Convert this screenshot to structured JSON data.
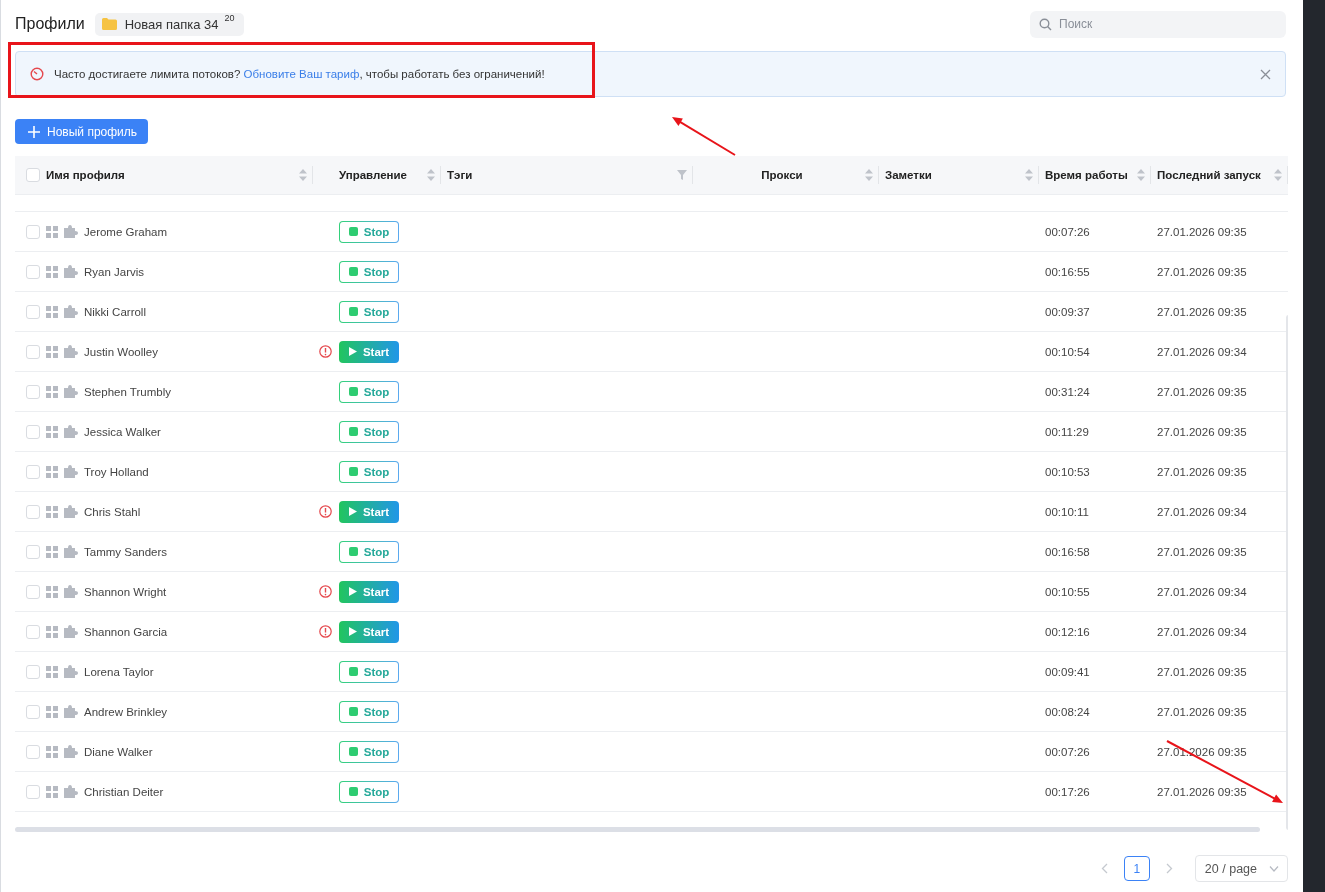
{
  "header": {
    "title": "Профили",
    "folder": {
      "name": "Новая папка 34",
      "count": "20"
    },
    "search": {
      "placeholder": "Поиск"
    }
  },
  "banner": {
    "text_before": "Часто достигаете лимита потоков? ",
    "link": "Обновите Ваш тариф",
    "text_after": ", чтобы работать без ограничений!"
  },
  "new_profile_button": {
    "label": "Новый профиль"
  },
  "table": {
    "select_all_checked": false,
    "columns": [
      {
        "label": "Имя профиля",
        "kind": "sort"
      },
      {
        "label": "Управление",
        "kind": "sort"
      },
      {
        "label": "Тэги",
        "kind": "filter"
      },
      {
        "label": "Прокси",
        "kind": "sort"
      },
      {
        "label": "Заметки",
        "kind": "sort"
      },
      {
        "label": "Время работы",
        "kind": "sort"
      },
      {
        "label": "Последний запуск",
        "kind": "sort"
      }
    ],
    "rows": [
      {
        "checked": false,
        "name": "Jerome Graham",
        "warning": false,
        "control": {
          "kind": "stop",
          "label": "Stop"
        },
        "uptime": "00:07:26",
        "last_launch": "27.01.2026 09:35"
      },
      {
        "checked": false,
        "name": "Ryan Jarvis",
        "warning": false,
        "control": {
          "kind": "stop",
          "label": "Stop"
        },
        "uptime": "00:16:55",
        "last_launch": "27.01.2026 09:35"
      },
      {
        "checked": false,
        "name": "Nikki Carroll",
        "warning": false,
        "control": {
          "kind": "stop",
          "label": "Stop"
        },
        "uptime": "00:09:37",
        "last_launch": "27.01.2026 09:35"
      },
      {
        "checked": false,
        "name": "Justin Woolley",
        "warning": true,
        "control": {
          "kind": "start",
          "label": "Start"
        },
        "uptime": "00:10:54",
        "last_launch": "27.01.2026 09:34"
      },
      {
        "checked": false,
        "name": "Stephen Trumbly",
        "warning": false,
        "control": {
          "kind": "stop",
          "label": "Stop"
        },
        "uptime": "00:31:24",
        "last_launch": "27.01.2026 09:35"
      },
      {
        "checked": false,
        "name": "Jessica Walker",
        "warning": false,
        "control": {
          "kind": "stop",
          "label": "Stop"
        },
        "uptime": "00:11:29",
        "last_launch": "27.01.2026 09:35"
      },
      {
        "checked": false,
        "name": "Troy Holland",
        "warning": false,
        "control": {
          "kind": "stop",
          "label": "Stop"
        },
        "uptime": "00:10:53",
        "last_launch": "27.01.2026 09:35"
      },
      {
        "checked": false,
        "name": "Chris Stahl",
        "warning": true,
        "control": {
          "kind": "start",
          "label": "Start"
        },
        "uptime": "00:10:11",
        "last_launch": "27.01.2026 09:34"
      },
      {
        "checked": false,
        "name": "Tammy Sanders",
        "warning": false,
        "control": {
          "kind": "stop",
          "label": "Stop"
        },
        "uptime": "00:16:58",
        "last_launch": "27.01.2026 09:35"
      },
      {
        "checked": false,
        "name": "Shannon Wright",
        "warning": true,
        "control": {
          "kind": "start",
          "label": "Start"
        },
        "uptime": "00:10:55",
        "last_launch": "27.01.2026 09:34"
      },
      {
        "checked": false,
        "name": "Shannon Garcia",
        "warning": true,
        "control": {
          "kind": "start",
          "label": "Start"
        },
        "uptime": "00:12:16",
        "last_launch": "27.01.2026 09:34"
      },
      {
        "checked": false,
        "name": "Lorena Taylor",
        "warning": false,
        "control": {
          "kind": "stop",
          "label": "Stop"
        },
        "uptime": "00:09:41",
        "last_launch": "27.01.2026 09:35"
      },
      {
        "checked": false,
        "name": "Andrew Brinkley",
        "warning": false,
        "control": {
          "kind": "stop",
          "label": "Stop"
        },
        "uptime": "00:08:24",
        "last_launch": "27.01.2026 09:35"
      },
      {
        "checked": false,
        "name": "Diane Walker",
        "warning": false,
        "control": {
          "kind": "stop",
          "label": "Stop"
        },
        "uptime": "00:07:26",
        "last_launch": "27.01.2026 09:35"
      },
      {
        "checked": false,
        "name": "Christian Deiter",
        "warning": false,
        "control": {
          "kind": "stop",
          "label": "Stop"
        },
        "uptime": "00:17:26",
        "last_launch": "27.01.2026 09:35"
      }
    ]
  },
  "pagination": {
    "pages": [
      {
        "label": "1",
        "selected": true
      }
    ],
    "page_size": "20 / page"
  },
  "annotations": [
    {
      "kind": "box"
    },
    {
      "kind": "arrow"
    },
    {
      "kind": "arrow"
    }
  ]
}
